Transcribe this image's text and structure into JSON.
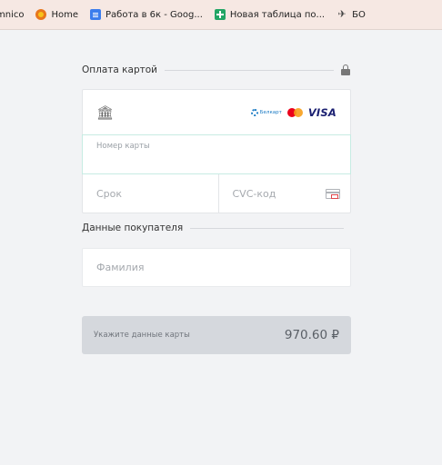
{
  "bookmarks": [
    {
      "label": "mnico",
      "icon": "none"
    },
    {
      "label": "Home",
      "icon": "home-orange-icon"
    },
    {
      "label": "Работа в 6к - Goog...",
      "icon": "google-docs-icon"
    },
    {
      "label": "Новая таблица по...",
      "icon": "google-sheets-icon"
    },
    {
      "label": "БО",
      "icon": "bird-icon"
    }
  ],
  "payment": {
    "title": "Оплата картой",
    "lock_icon": "lock-icon",
    "bank_icon": "bank-icon",
    "brands": {
      "belkart": "Белкарт",
      "mastercard": "mastercard-icon",
      "visa": "VISA"
    },
    "card_number_label": "Номер карты",
    "expiry_placeholder": "Срок",
    "cvc_placeholder": "CVC-код"
  },
  "buyer": {
    "title": "Данные покупателя",
    "surname_placeholder": "Фамилия"
  },
  "pay_button": {
    "label": "Укажите данные карты",
    "amount": "970.60 ₽"
  },
  "colors": {
    "background": "#f2f3f5",
    "card_number_border": "#c7ece3",
    "pay_button_bg": "#d5d8dd",
    "visa_blue": "#1a1f71"
  }
}
